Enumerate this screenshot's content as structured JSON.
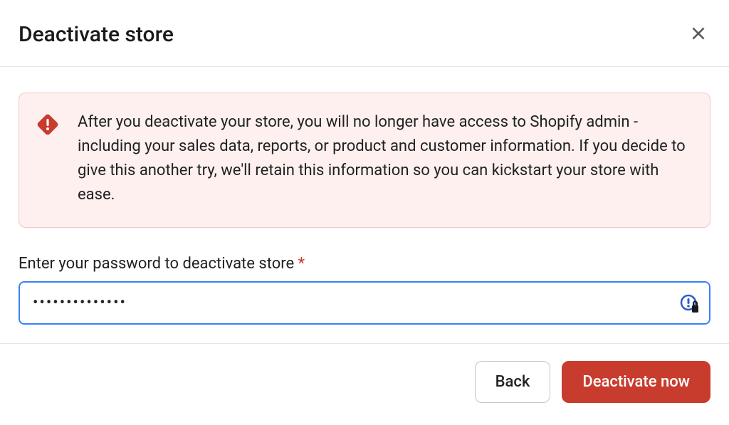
{
  "header": {
    "title": "Deactivate store"
  },
  "alert": {
    "message": "After you deactivate your store, you will no longer have access to Shopify admin - including your sales data, reports, or product and customer information. If you decide to give this another try, we'll retain this information so you can kickstart your store with ease."
  },
  "form": {
    "password_label": "Enter your password to deactivate store",
    "required_mark": "*",
    "password_value": "••••••••••••••"
  },
  "footer": {
    "back_label": "Back",
    "deactivate_label": "Deactivate now"
  },
  "colors": {
    "alert_bg": "#fdf0ee",
    "alert_border": "#f0c9c6",
    "alert_icon": "#c83c2e",
    "primary_btn": "#c83c2e",
    "input_focus_border": "#3b82f6"
  }
}
